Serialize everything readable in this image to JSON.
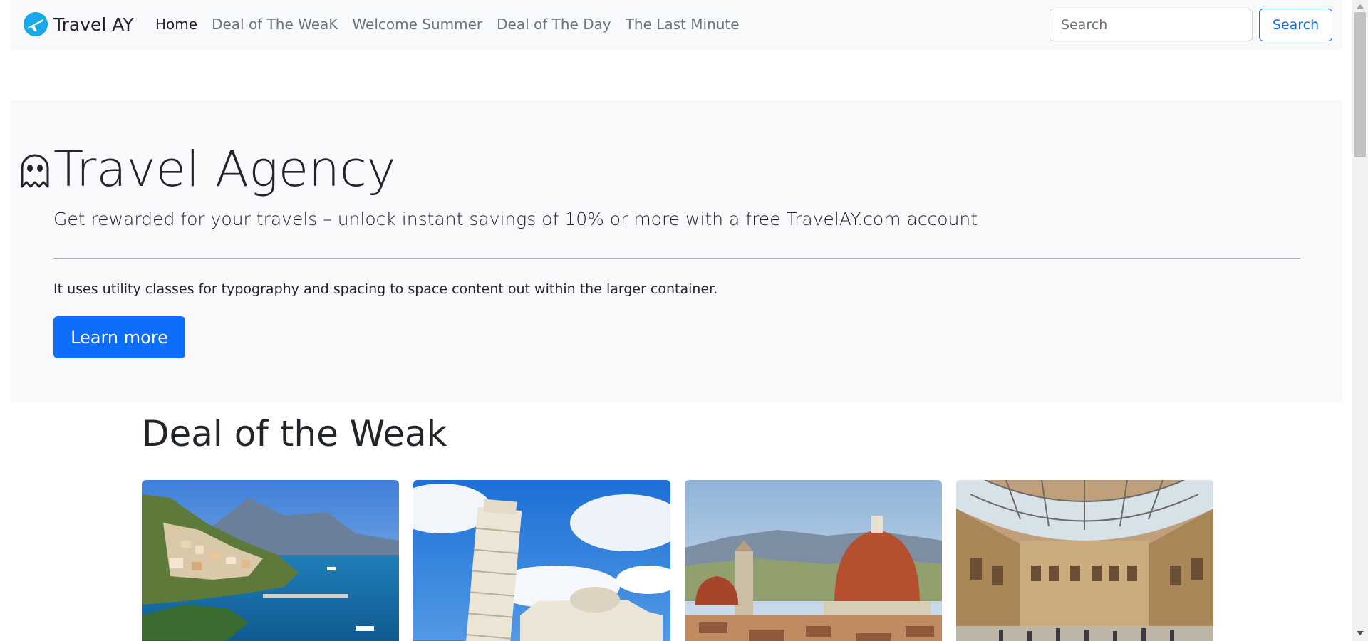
{
  "navbar": {
    "brand": "Travel AY",
    "brand_icon": "airplane-icon",
    "links": [
      {
        "label": "Home",
        "active": true
      },
      {
        "label": "Deal of The WeaK",
        "active": false
      },
      {
        "label": "Welcome Summer",
        "active": false
      },
      {
        "label": "Deal of The Day",
        "active": false
      },
      {
        "label": "The Last Minute",
        "active": false
      }
    ],
    "search": {
      "placeholder": "Search",
      "value": "",
      "button": "Search"
    }
  },
  "hero": {
    "icon": "ghost-icon",
    "title": "Travel Agency",
    "lead": "Get rewarded for your travels – unlock instant savings of 10% or more with a free TravelAY.com account",
    "text": "It uses utility classes for typography and spacing to space content out within the larger container.",
    "button": "Learn more"
  },
  "deals": {
    "title": "Deal of the Weak",
    "cards": [
      {
        "image": "amalfi-coast-photo"
      },
      {
        "image": "leaning-tower-of-pisa-photo"
      },
      {
        "image": "florence-cathedral-photo"
      },
      {
        "image": "milan-galleria-photo"
      }
    ]
  },
  "colors": {
    "primary": "#0d6efd",
    "navbar_bg": "#f8f9fa",
    "hero_bg": "#f8f9fa",
    "text": "#212529",
    "muted": "#6c757d",
    "brand_icon": "#1ba8e8"
  }
}
